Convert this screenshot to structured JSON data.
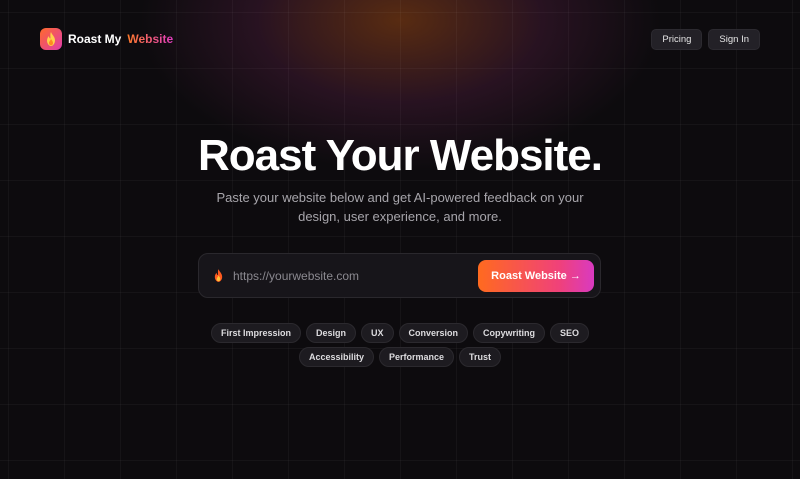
{
  "header": {
    "brand_name": "Roast My",
    "brand_accent": "Website",
    "logo_icon": "flame-icon",
    "nav": [
      {
        "label": "Pricing"
      },
      {
        "label": "Sign In"
      }
    ]
  },
  "hero": {
    "title": "Roast Your Website.",
    "subtitle": "Paste your website below and get AI-powered feedback on your design, user experience, and more."
  },
  "search": {
    "icon": "flame-icon",
    "placeholder": "https://yourwebsite.com",
    "value": "",
    "button_label": "Roast Website →"
  },
  "tags": [
    "First Impression",
    "Design",
    "UX",
    "Conversion",
    "Copywriting",
    "SEO",
    "Accessibility",
    "Performance",
    "Trust"
  ],
  "colors": {
    "background": "#0d0b0e",
    "accent_start": "#ff6a1f",
    "accent_end": "#d93ac0"
  }
}
